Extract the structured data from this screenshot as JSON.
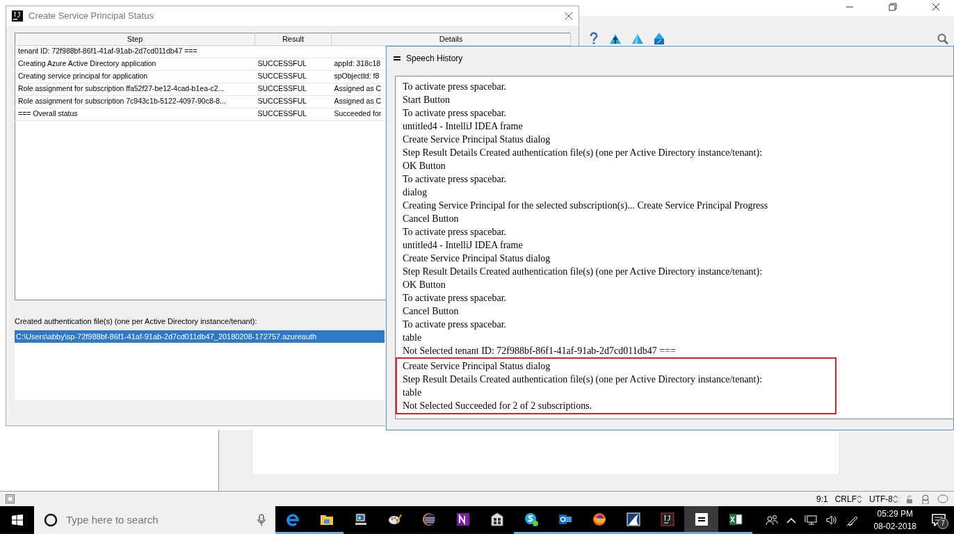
{
  "status_dialog": {
    "title": "Create Service Principal Status",
    "table": {
      "columns": [
        "Step",
        "Result",
        "Details"
      ],
      "rows": [
        {
          "step": "tenant ID: 72f988bf-86f1-41af-91ab-2d7cd011db47 ===",
          "result": "",
          "details": ""
        },
        {
          "step": "Creating Azure Active Directory application",
          "result": "SUCCESSFUL",
          "details": "appId: 318c18"
        },
        {
          "step": "Creating service principal for application",
          "result": "SUCCESSFUL",
          "details": "spObjectId: f8"
        },
        {
          "step": "Role assignment for subscription ffa52f27-be12-4cad-b1ea-c2...",
          "result": "SUCCESSFUL",
          "details": "Assigned as C"
        },
        {
          "step": "Role assignment for subscription 7c943c1b-5122-4097-90c8-8...",
          "result": "SUCCESSFUL",
          "details": "Assigned as C"
        },
        {
          "step": "=== Overall status",
          "result": "SUCCESSFUL",
          "details": "Succeeded for"
        }
      ]
    },
    "files_label": "Created authentication file(s) (one per Active Directory instance/tenant):",
    "files": [
      {
        "path": "C:\\Users\\abby\\sp-72f988bf-86f1-41af-91ab-2d7cd011db47_20180208-172757.azureauth",
        "selected": true
      }
    ]
  },
  "speech_history": {
    "title": "Speech History",
    "lines": [
      "To activate press spacebar.",
      "Start Button",
      "To activate press spacebar.",
      "untitled4 - IntelliJ IDEA frame",
      "Create Service Principal Status dialog",
      "Step Result Details Created authentication file(s) (one per Active Directory instance/tenant):",
      "OK Button",
      "To activate press spacebar.",
      "dialog",
      "Creating Service Principal for the selected subscription(s)... Create Service Principal Progress",
      "Cancel Button",
      "To activate press spacebar.",
      "untitled4 - IntelliJ IDEA frame",
      "Create Service Principal Status dialog",
      "Step Result Details Created authentication file(s) (one per Active Directory instance/tenant):",
      "OK Button",
      "To activate press spacebar.",
      "Cancel Button",
      "To activate press spacebar.",
      "table",
      "Not Selected tenant ID: 72f988bf-86f1-41af-91ab-2d7cd011db47 ==="
    ],
    "highlighted_lines": [
      "Create Service Principal Status dialog",
      "Step Result Details Created authentication file(s) (one per Active Directory instance/tenant):",
      "table",
      "Not Selected Succeeded for 2 of 2 subscriptions."
    ]
  },
  "status_bar": {
    "position": "9:1",
    "line_separator": "CRLF",
    "encoding": "UTF-8"
  },
  "taskbar": {
    "search": {
      "placeholder": "Type here to search"
    },
    "apps": [
      {
        "running": true,
        "selected": false
      },
      {
        "running": true,
        "selected": false
      },
      {
        "running": false,
        "selected": false
      },
      {
        "running": false,
        "selected": false
      },
      {
        "running": false,
        "selected": false
      },
      {
        "running": false,
        "selected": false
      },
      {
        "running": false,
        "selected": false
      },
      {
        "running": true,
        "selected": false
      },
      {
        "running": true,
        "selected": false
      },
      {
        "running": true,
        "selected": false
      },
      {
        "running": true,
        "selected": false
      },
      {
        "running": true,
        "selected": false
      },
      {
        "running": true,
        "selected": true
      },
      {
        "running": true,
        "selected": false
      }
    ],
    "time": "05:29 PM",
    "date": "08-02-2018",
    "notifications": "7"
  }
}
